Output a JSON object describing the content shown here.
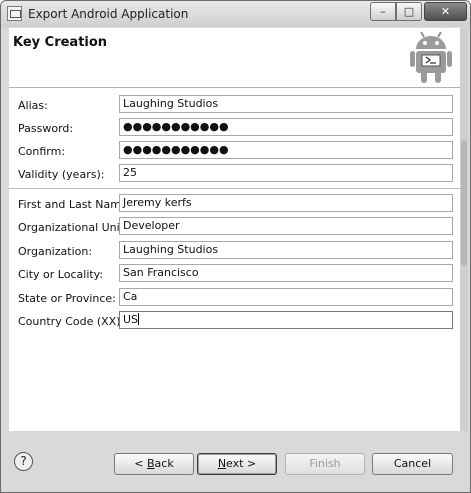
{
  "window": {
    "title": "Export Android Application",
    "minimize": "–",
    "maximize": "□",
    "close": "✕"
  },
  "header": {
    "title": "Key Creation",
    "icon": "android-robot-icon"
  },
  "form": {
    "alias": {
      "label": "Alias:",
      "value": "Laughing Studios"
    },
    "password": {
      "label": "Password:",
      "value": "●●●●●●●●●●●"
    },
    "confirm": {
      "label": "Confirm:",
      "value": "●●●●●●●●●●●"
    },
    "validity": {
      "label": "Validity (years):",
      "value": "25"
    },
    "name": {
      "label": "First and Last Name:",
      "value": "Jeremy kerfs"
    },
    "unit": {
      "label": "Organizational Unit:",
      "value": "Developer"
    },
    "organization": {
      "label": "Organization:",
      "value": "Laughing Studios"
    },
    "city": {
      "label": "City or Locality:",
      "value": "San Francisco"
    },
    "state": {
      "label": "State or Province:",
      "value": "Ca"
    },
    "country": {
      "label": "Country Code (XX):",
      "value": "US"
    }
  },
  "footer": {
    "help": "?",
    "back_arrow": "< ",
    "back_key": "B",
    "back_rest": "ack",
    "next_key": "N",
    "next_rest": "ext >",
    "finish": "Finish",
    "cancel": "Cancel"
  }
}
